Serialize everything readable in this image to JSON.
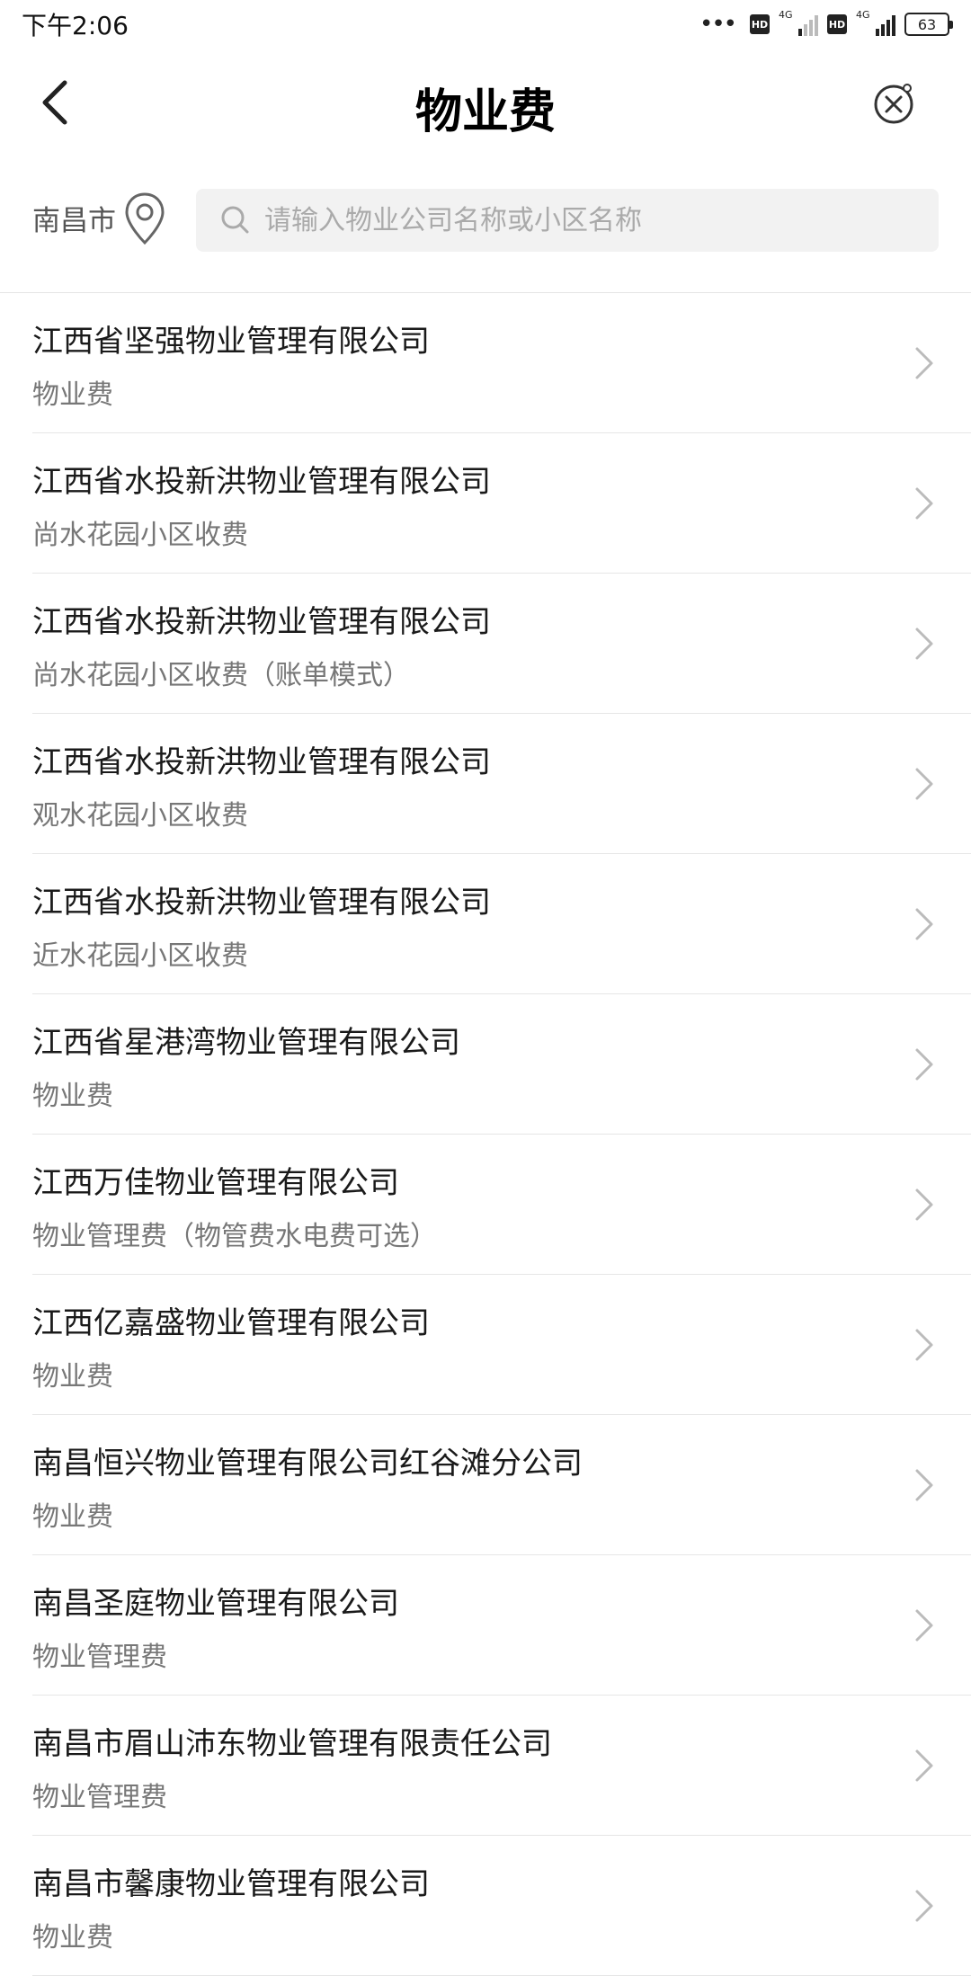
{
  "status_bar": {
    "time": "下午2:06",
    "dots": "•••",
    "hd1": "HD",
    "net1": "4G",
    "hd2": "HD",
    "net2": "4G",
    "battery": "63"
  },
  "header": {
    "title": "物业费",
    "back_icon": "chevron-left-icon",
    "close_icon": "close-circle-icon"
  },
  "search": {
    "city": "南昌市",
    "placeholder": "请输入物业公司名称或小区名称"
  },
  "list": [
    {
      "title": "江西省坚强物业管理有限公司",
      "subtitle": "物业费"
    },
    {
      "title": "江西省水投新洪物业管理有限公司",
      "subtitle": "尚水花园小区收费"
    },
    {
      "title": "江西省水投新洪物业管理有限公司",
      "subtitle": "尚水花园小区收费（账单模式）"
    },
    {
      "title": "江西省水投新洪物业管理有限公司",
      "subtitle": "观水花园小区收费"
    },
    {
      "title": "江西省水投新洪物业管理有限公司",
      "subtitle": "近水花园小区收费"
    },
    {
      "title": "江西省星港湾物业管理有限公司",
      "subtitle": "物业费"
    },
    {
      "title": "江西万佳物业管理有限公司",
      "subtitle": "物业管理费（物管费水电费可选）"
    },
    {
      "title": "江西亿嘉盛物业管理有限公司",
      "subtitle": "物业费"
    },
    {
      "title": "南昌恒兴物业管理有限公司红谷滩分公司",
      "subtitle": "物业费"
    },
    {
      "title": "南昌圣庭物业管理有限公司",
      "subtitle": "物业管理费"
    },
    {
      "title": "南昌市眉山沛东物业管理有限责任公司",
      "subtitle": "物业管理费"
    },
    {
      "title": "南昌市馨康物业管理有限公司",
      "subtitle": "物业费"
    }
  ]
}
